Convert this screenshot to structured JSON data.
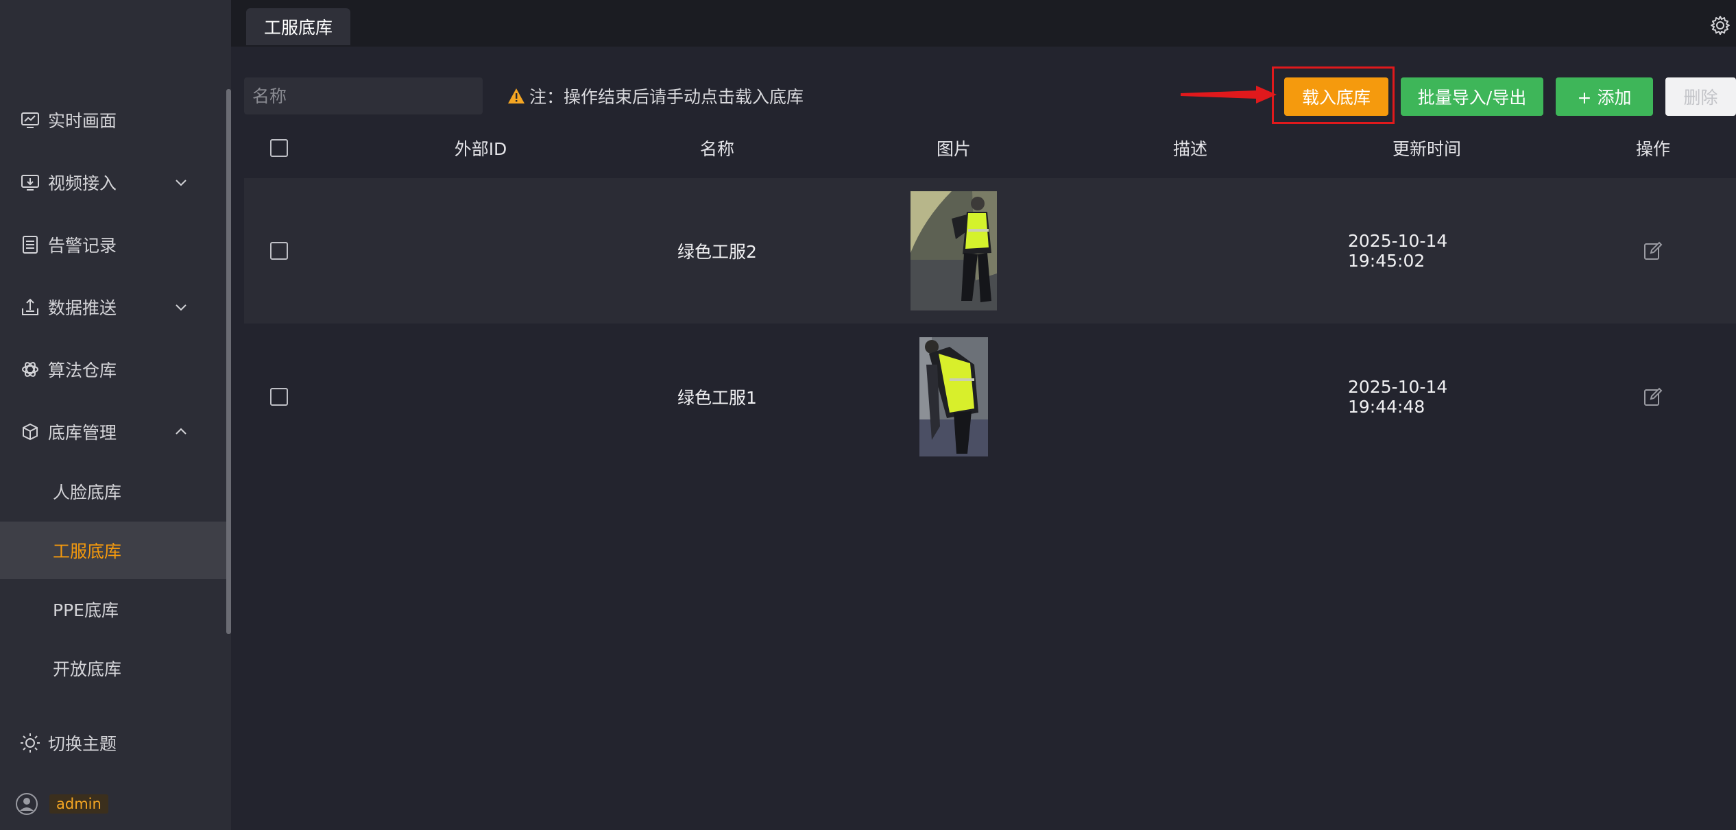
{
  "sidebar": {
    "items": [
      {
        "label": "实时画面",
        "icon": "monitor-chart-icon"
      },
      {
        "label": "视频接入",
        "icon": "video-input-icon"
      },
      {
        "label": "告警记录",
        "icon": "list-document-icon"
      },
      {
        "label": "数据推送",
        "icon": "upload-tray-icon"
      },
      {
        "label": "算法仓库",
        "icon": "atom-icon"
      },
      {
        "label": "底库管理",
        "icon": "cube-icon"
      }
    ],
    "sub_items": [
      {
        "label": "人脸底库"
      },
      {
        "label": "工服底库"
      },
      {
        "label": "PPE底库"
      },
      {
        "label": "开放底库"
      }
    ],
    "theme_label": "切换主题",
    "username": "admin"
  },
  "topbar": {
    "tab_label": "工服底库"
  },
  "toolbar": {
    "search_placeholder": "名称",
    "note": "注：操作结束后请手动点击载入底库",
    "load_label": "载入底库",
    "batch_label": "批量导入/导出",
    "add_label": "+  添加",
    "delete_label": "删除"
  },
  "table": {
    "columns": [
      "外部ID",
      "名称",
      "图片",
      "描述",
      "更新时间",
      "操作"
    ],
    "rows": [
      {
        "external_id": "",
        "name": "绿色工服2",
        "description": "",
        "updated": "2025-10-14 19:45:02"
      },
      {
        "external_id": "",
        "name": "绿色工服1",
        "description": "",
        "updated": "2025-10-14 19:44:48"
      }
    ]
  },
  "colors": {
    "accent": "#f59a0d",
    "green": "#3eb659",
    "highlight": "#e0191c",
    "background": "#23242e",
    "sidebar": "#2c2d36"
  }
}
